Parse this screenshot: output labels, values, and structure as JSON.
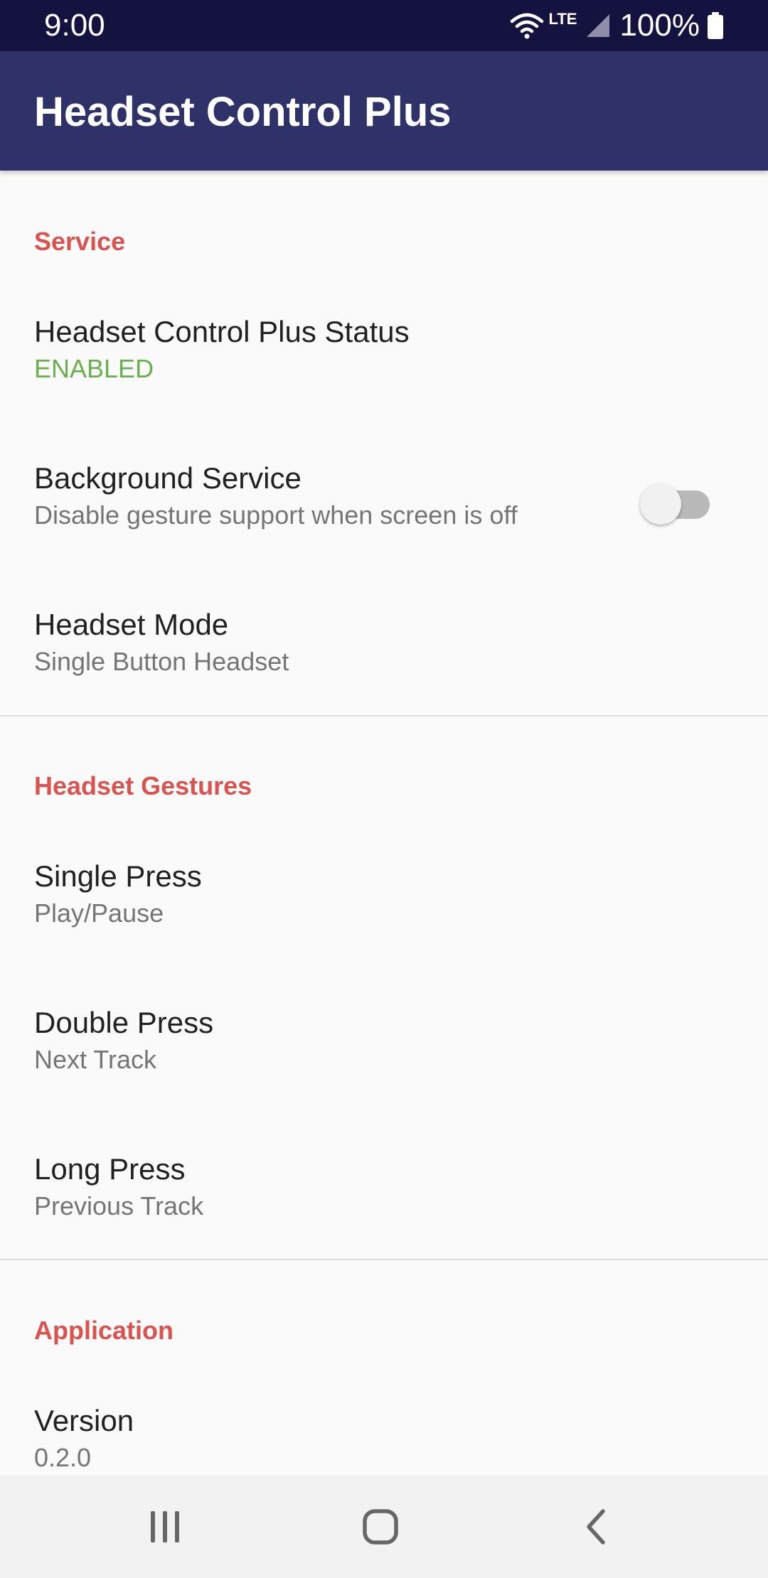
{
  "status_bar": {
    "time": "9:00",
    "network": "LTE",
    "battery": "100%",
    "icons": [
      "wifi-icon",
      "signal-icon",
      "battery-icon"
    ]
  },
  "app_bar": {
    "title": "Headset Control Plus"
  },
  "sections": {
    "service": {
      "header": "Service",
      "status": {
        "title": "Headset Control Plus Status",
        "summary": "ENABLED"
      },
      "background": {
        "title": "Background Service",
        "summary": "Disable gesture support when screen is off",
        "toggle_on": false
      },
      "mode": {
        "title": "Headset Mode",
        "summary": "Single Button Headset"
      }
    },
    "gestures": {
      "header": "Headset Gestures",
      "single": {
        "title": "Single Press",
        "summary": "Play/Pause"
      },
      "double": {
        "title": "Double Press",
        "summary": "Next Track"
      },
      "long": {
        "title": "Long Press",
        "summary": "Previous Track"
      }
    },
    "application": {
      "header": "Application",
      "version": {
        "title": "Version",
        "summary": "0.2.0"
      }
    }
  },
  "nav_bar": {
    "icons": [
      "recents-icon",
      "home-icon",
      "back-icon"
    ]
  },
  "colors": {
    "status_bar": "#141340",
    "app_bar": "#2f3169",
    "section_header": "#d9534f",
    "enabled": "#6ab04c",
    "background": "#fafafa"
  }
}
